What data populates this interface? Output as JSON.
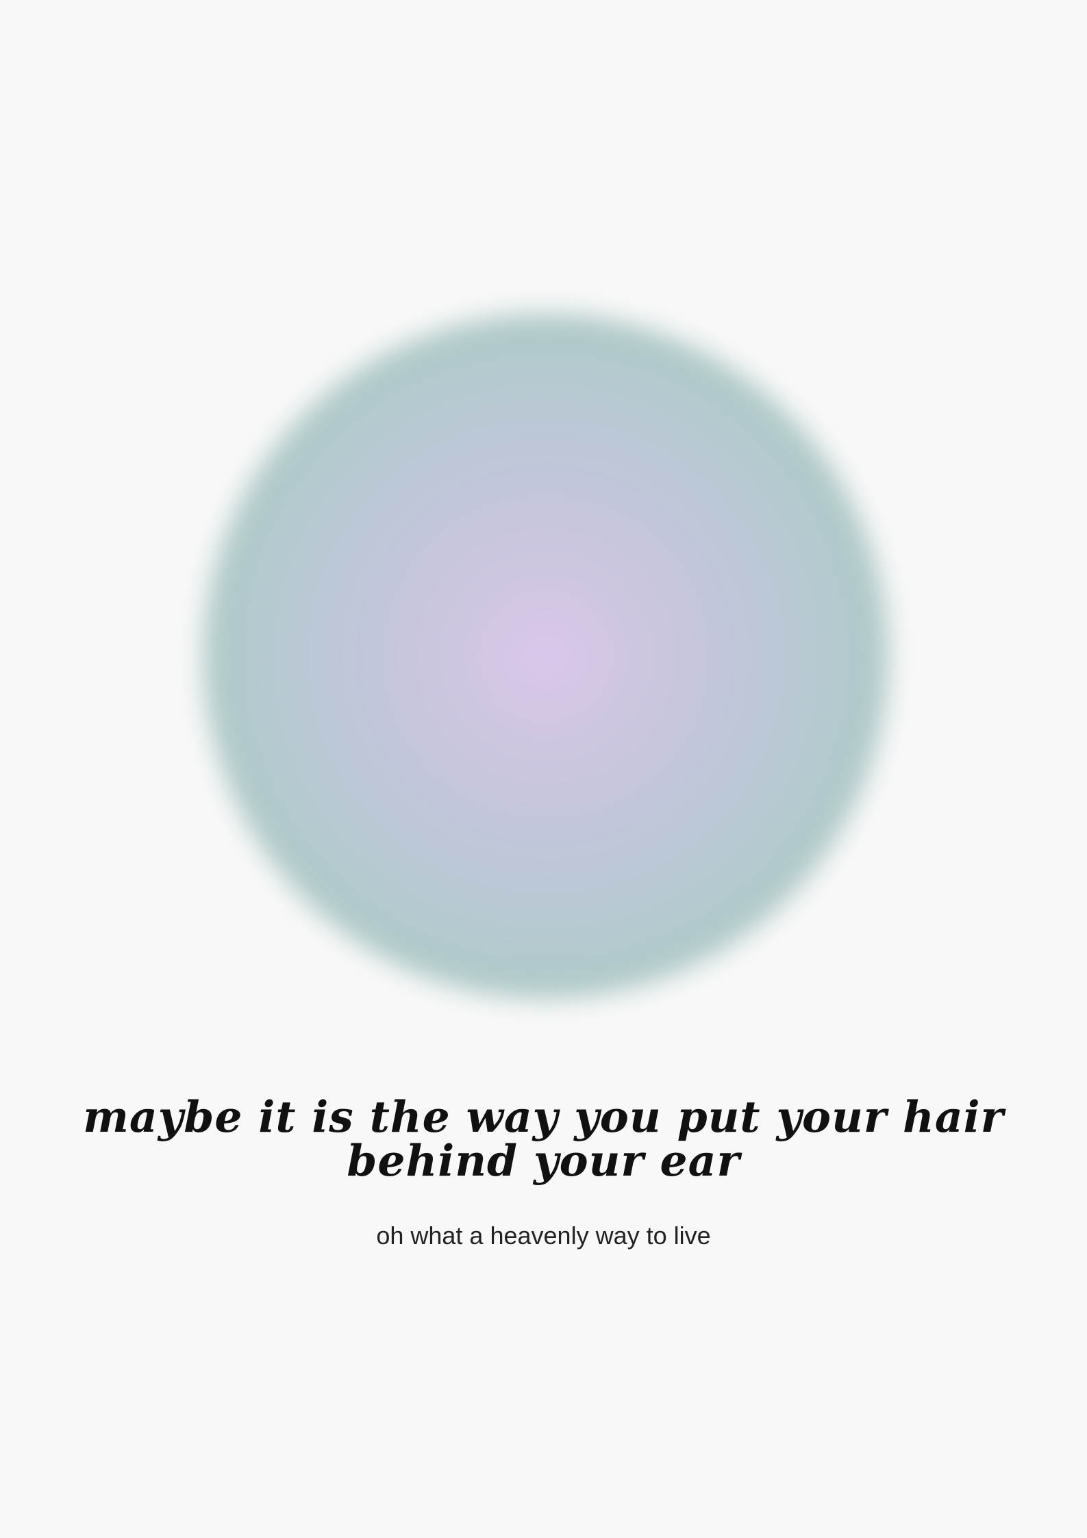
{
  "colors": {
    "background": "#f8f8f8",
    "aura_center": "#dac7ec",
    "aura_edge": "#a4c8b9",
    "text": "#111111"
  },
  "quote": {
    "line1": "maybe it is the way you put your hair",
    "line2": "behind your ear"
  },
  "subline": "oh what a heavenly way to live"
}
